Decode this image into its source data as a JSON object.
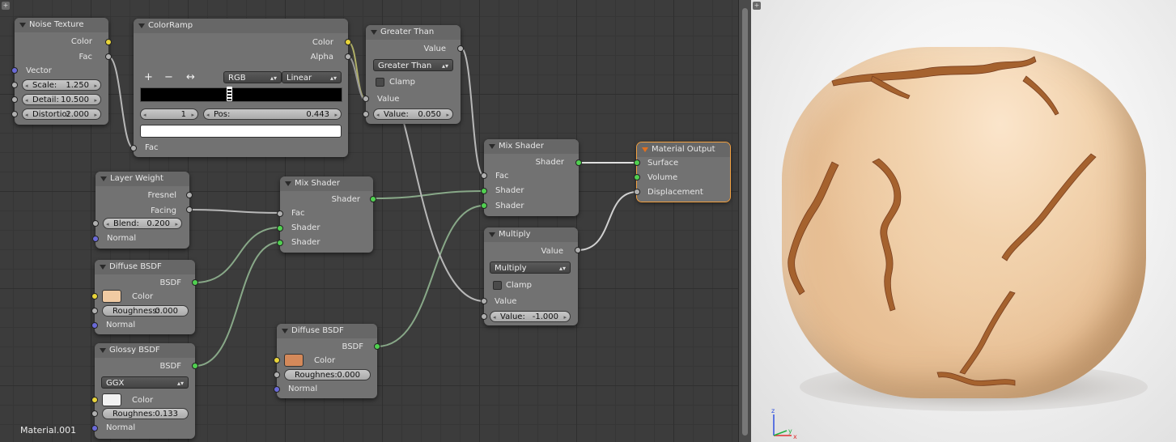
{
  "editor": {
    "material_name": "Material.001",
    "nodes": {
      "noise_texture": {
        "title": "Noise Texture",
        "out_color": "Color",
        "out_fac": "Fac",
        "in_vector": "Vector",
        "scale_label": "Scale:",
        "scale_value": "1.250",
        "detail_label": "Detail:",
        "detail_value": "10.500",
        "distortion_label": "Distortio:",
        "distortion_value": "2.000"
      },
      "color_ramp": {
        "title": "ColorRamp",
        "out_color": "Color",
        "out_alpha": "Alpha",
        "add_tool": "+",
        "remove_tool": "−",
        "flip_tool": "↔",
        "color_mode": "RGB",
        "interpolation": "Linear",
        "stop_index": "1",
        "pos_label": "Pos:",
        "pos_value": "0.443",
        "in_fac": "Fac"
      },
      "greater_than": {
        "title": "Greater Than",
        "out_value": "Value",
        "operation": "Greater Than",
        "clamp_label": "Clamp",
        "in_value": "Value",
        "value_label": "Value:",
        "value_value": "0.050"
      },
      "layer_weight": {
        "title": "Layer Weight",
        "out_fresnel": "Fresnel",
        "out_facing": "Facing",
        "blend_label": "Blend:",
        "blend_value": "0.200",
        "in_normal": "Normal"
      },
      "mix_shader_1": {
        "title": "Mix Shader",
        "out_shader": "Shader",
        "in_fac": "Fac",
        "in_shader_a": "Shader",
        "in_shader_b": "Shader"
      },
      "mix_shader_2": {
        "title": "Mix Shader",
        "out_shader": "Shader",
        "in_fac": "Fac",
        "in_shader_a": "Shader",
        "in_shader_b": "Shader"
      },
      "material_output": {
        "title": "Material Output",
        "in_surface": "Surface",
        "in_volume": "Volume",
        "in_displacement": "Displacement"
      },
      "multiply": {
        "title": "Multiply",
        "out_value": "Value",
        "operation": "Multiply",
        "clamp_label": "Clamp",
        "in_value": "Value",
        "value_label": "Value:",
        "value_value": "-1.000"
      },
      "diffuse_bsdf_1": {
        "title": "Diffuse BSDF",
        "out_bsdf": "BSDF",
        "color_label": "Color",
        "color_value": "#f0caa2",
        "roughness_label": "Roughness:",
        "roughness_value": "0.000",
        "in_normal": "Normal"
      },
      "glossy_bsdf": {
        "title": "Glossy BSDF",
        "out_bsdf": "BSDF",
        "distribution": "GGX",
        "color_label": "Color",
        "color_value": "#f2f2f2",
        "roughness_label": "Roughnes:",
        "roughness_value": "0.133",
        "in_normal": "Normal"
      },
      "diffuse_bsdf_2": {
        "title": "Diffuse BSDF",
        "out_bsdf": "BSDF",
        "color_label": "Color",
        "color_value": "#d4895a",
        "roughness_label": "Roughnes:",
        "roughness_value": "0.000",
        "in_normal": "Normal"
      }
    }
  },
  "viewport": {
    "axis_x": "x",
    "axis_y": "y",
    "axis_z": "z"
  },
  "colors": {
    "socket_color": "#e8d43a",
    "socket_value": "#b0b0b0",
    "socket_shader": "#50d050",
    "socket_vector": "#6a6ad8",
    "active_outline": "#f2a040"
  }
}
